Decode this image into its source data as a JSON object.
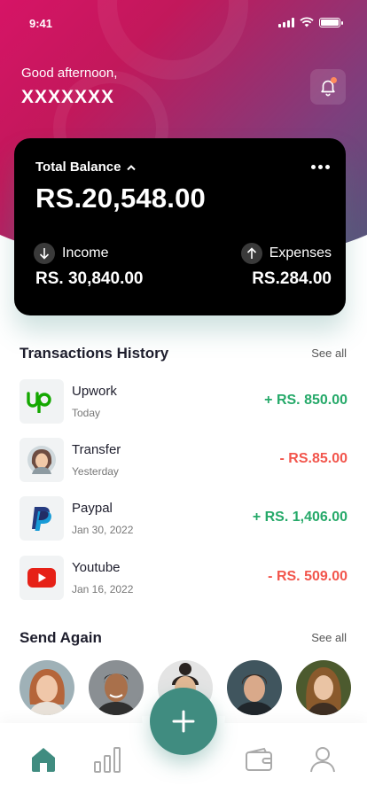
{
  "status_bar": {
    "time": "9:41"
  },
  "header": {
    "greeting": "Good afternoon,",
    "username": "XXXXXXX"
  },
  "balance_card": {
    "title": "Total Balance",
    "amount": "RS.20,548.00",
    "income_label": "Income",
    "income_value": "RS. 30,840.00",
    "expenses_label": "Expenses",
    "expenses_value": "RS.284.00"
  },
  "transactions": {
    "title": "Transactions History",
    "see_all": "See all",
    "items": [
      {
        "name": "Upwork",
        "date": "Today",
        "amount": "+ RS. 850.00",
        "icon": "upwork-logo"
      },
      {
        "name": "Transfer",
        "date": "Yesterday",
        "amount": "- RS.85.00",
        "icon": "person-avatar"
      },
      {
        "name": "Paypal",
        "date": "Jan 30, 2022",
        "amount": "+ RS. 1,406.00",
        "icon": "paypal-logo"
      },
      {
        "name": "Youtube",
        "date": "Jan 16, 2022",
        "amount": "- RS. 509.00",
        "icon": "youtube-logo"
      }
    ]
  },
  "send_again": {
    "title": "Send Again",
    "see_all": "See all"
  },
  "colors": {
    "accent": "#408c80",
    "positive": "#25a969",
    "negative": "#f2554c",
    "header_start": "#e0126b",
    "header_end": "#45607a"
  },
  "nav": {
    "items": [
      "home-icon",
      "stats-icon",
      "add-icon",
      "wallet-icon",
      "profile-icon"
    ]
  }
}
